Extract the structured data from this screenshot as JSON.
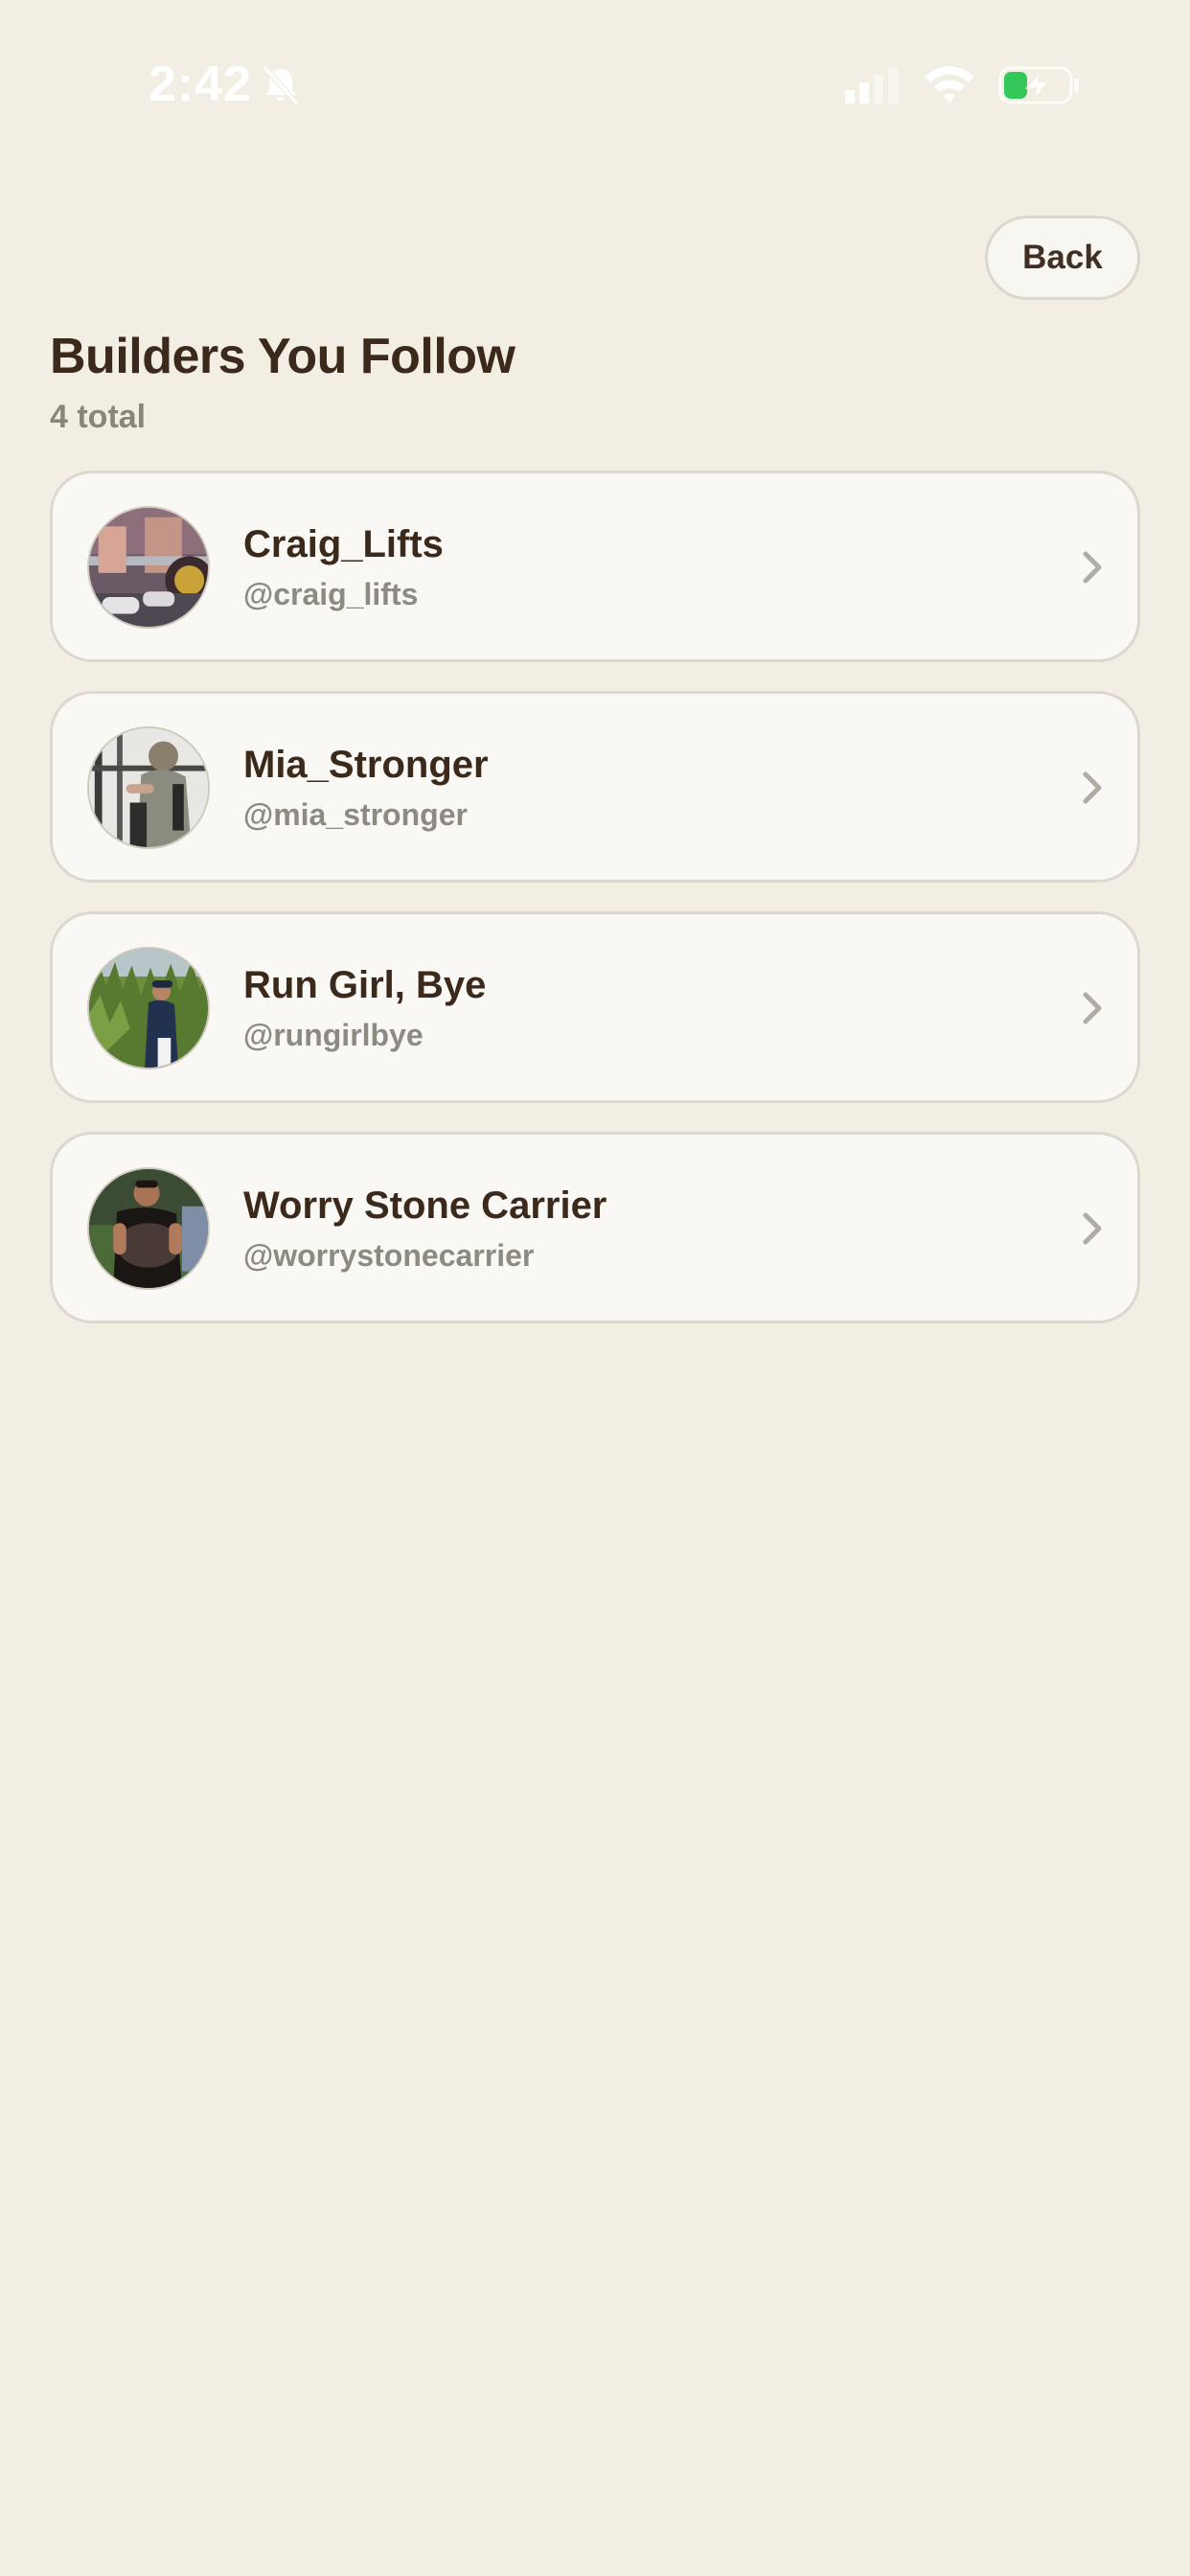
{
  "status_bar": {
    "time": "2:42",
    "icons": [
      "bell-slash-icon",
      "cellular-signal-icon",
      "wifi-icon",
      "battery-charging-icon"
    ]
  },
  "header": {
    "back_label": "Back",
    "title": "Builders You Follow",
    "subtitle": "4 total"
  },
  "builders": [
    {
      "name": "Craig_Lifts",
      "handle": "@craig_lifts"
    },
    {
      "name": "Mia_Stronger",
      "handle": "@mia_stronger"
    },
    {
      "name": "Run Girl, Bye",
      "handle": "@rungirlbye"
    },
    {
      "name": "Worry Stone Carrier",
      "handle": "@worrystonecarrier"
    }
  ],
  "colors": {
    "background": "#f2eee4",
    "card": "#f9f8f4",
    "title": "#3b2a1c",
    "muted": "#8e8a82",
    "battery_accent": "#34c759"
  }
}
